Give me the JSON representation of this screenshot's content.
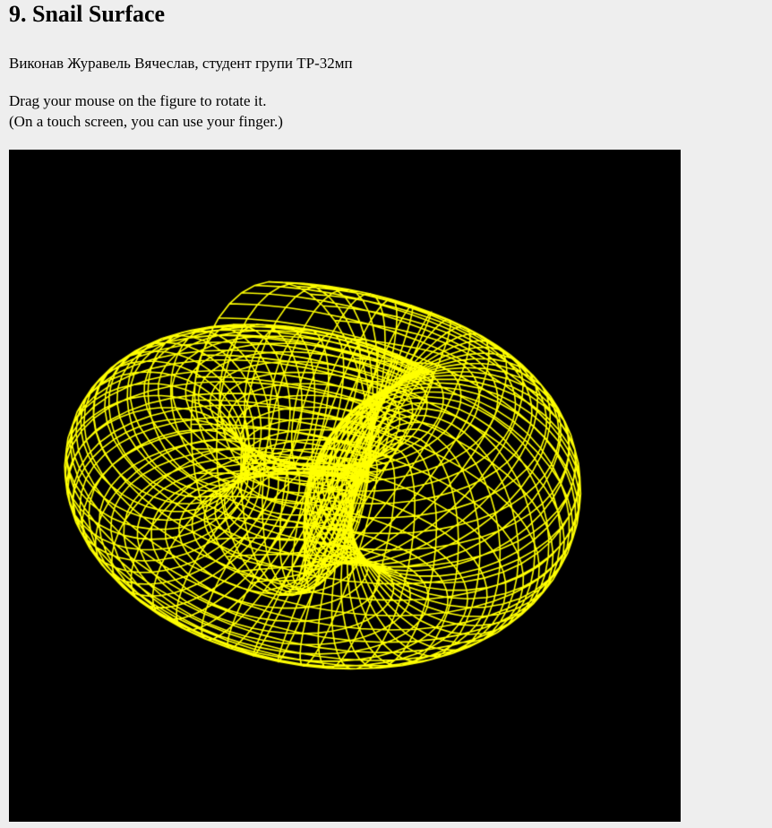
{
  "page": {
    "title": "9. Snail Surface",
    "author_line": "Виконав Журавель Вячеслав, студент групи ТР-32мп",
    "instructions": [
      "Drag your mouse on the figure to rotate it.",
      "(On a touch screen, you can use your finger.)"
    ]
  },
  "viewer": {
    "background_color": "#000000",
    "wireframe_color": "#ffff00",
    "surface_name": "snail-surface"
  }
}
